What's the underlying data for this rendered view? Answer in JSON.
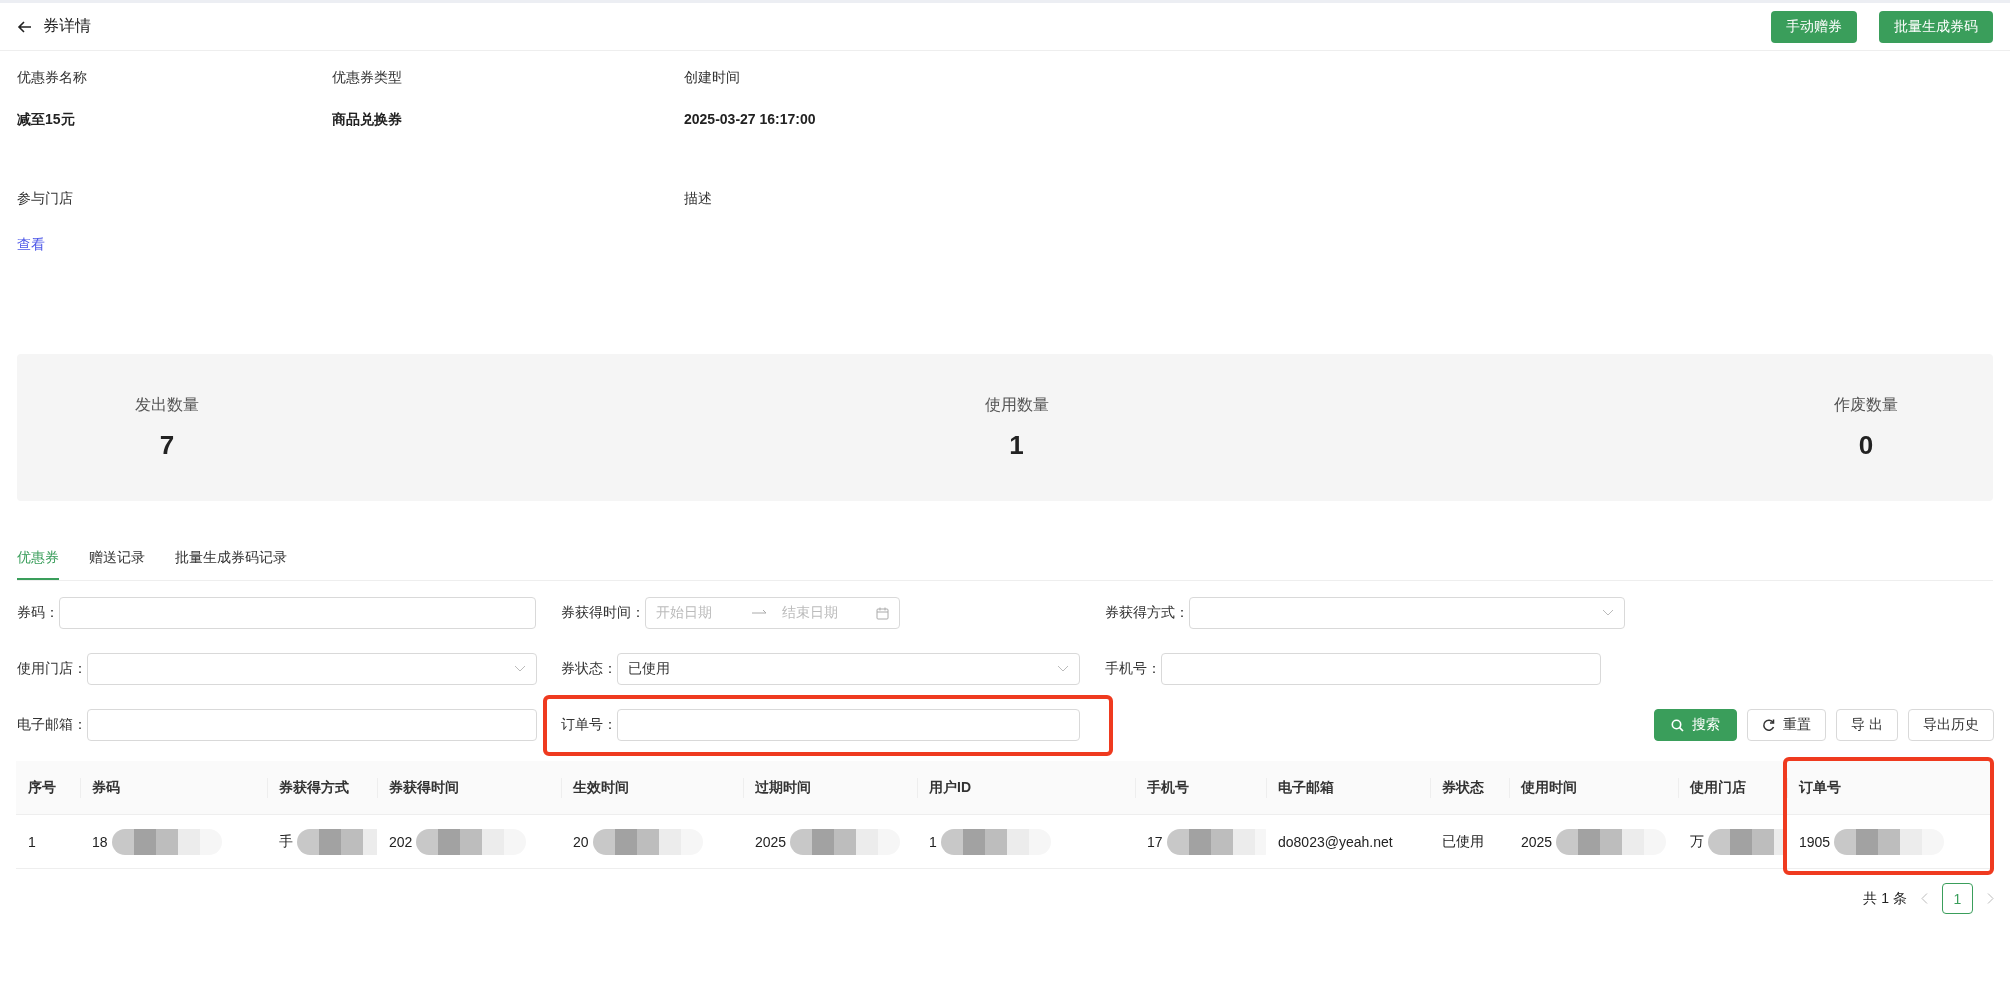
{
  "header": {
    "title": "券详情",
    "buttons": [
      "手动赠券",
      "批量生成券码"
    ]
  },
  "info": [
    {
      "label": "优惠券名称",
      "value": "减至15元"
    },
    {
      "label": "优惠券类型",
      "value": "商品兑换券"
    },
    {
      "label": "创建时间",
      "value": "2025-03-27 16:17:00"
    }
  ],
  "info_row2": [
    {
      "label": "参与门店",
      "link": "查看"
    },
    {
      "label": "描述"
    }
  ],
  "stats": [
    {
      "label": "发出数量",
      "value": "7"
    },
    {
      "label": "使用数量",
      "value": "1"
    },
    {
      "label": "作废数量",
      "value": "0"
    }
  ],
  "tabs": [
    {
      "label": "优惠券",
      "selected": true
    },
    {
      "label": "赠送记录",
      "selected": false
    },
    {
      "label": "批量生成券码记录",
      "selected": false
    }
  ],
  "filters": [
    {
      "kind": "text",
      "label": "券码："
    },
    {
      "kind": "daterange",
      "label": "券获得时间：",
      "start_placeholder": "开始日期",
      "end_placeholder": "结束日期"
    },
    {
      "kind": "select",
      "label": "券获得方式："
    },
    {
      "kind": "select",
      "label": "使用门店："
    },
    {
      "kind": "select",
      "label": "券状态：",
      "value": "已使用"
    },
    {
      "kind": "text",
      "label": "手机号："
    },
    {
      "kind": "text",
      "label": "电子邮箱："
    },
    {
      "kind": "text",
      "label": "订单号：",
      "highlighted": true
    }
  ],
  "actions": [
    {
      "label": "搜索",
      "kind": "primary"
    },
    {
      "label": "重置",
      "kind": "reset"
    },
    {
      "label": "导 出",
      "kind": "plain"
    },
    {
      "label": "导出历史",
      "kind": "plain"
    }
  ],
  "table": {
    "columns": [
      {
        "label": "序号"
      },
      {
        "label": "券码"
      },
      {
        "label": "券获得方式"
      },
      {
        "label": "券获得时间"
      },
      {
        "label": "生效时间"
      },
      {
        "label": "过期时间"
      },
      {
        "label": "用户ID"
      },
      {
        "label": "手机号"
      },
      {
        "label": "电子邮箱"
      },
      {
        "label": "券状态"
      },
      {
        "label": "使用时间"
      },
      {
        "label": "使用门店"
      },
      {
        "label": "订单号",
        "highlighted": true
      }
    ],
    "rows": [
      [
        {
          "text": "1",
          "redacted": false
        },
        {
          "text": "18",
          "redacted": true
        },
        {
          "text": "手",
          "redacted": true
        },
        {
          "text": "202",
          "redacted": true
        },
        {
          "text": "20",
          "redacted": true
        },
        {
          "text": "2025",
          "redacted": true
        },
        {
          "text": "1",
          "redacted": true
        },
        {
          "text": "17",
          "redacted": true
        },
        {
          "text": "do8023@yeah.net",
          "redacted": false
        },
        {
          "text": "已使用",
          "redacted": false
        },
        {
          "text": "2025",
          "redacted": true
        },
        {
          "text": "万",
          "redacted": true
        },
        {
          "text": "1905",
          "redacted": true
        }
      ]
    ]
  },
  "pagination": {
    "total": "共 1 条",
    "pages": [
      {
        "label": "1",
        "selected": true
      }
    ]
  }
}
